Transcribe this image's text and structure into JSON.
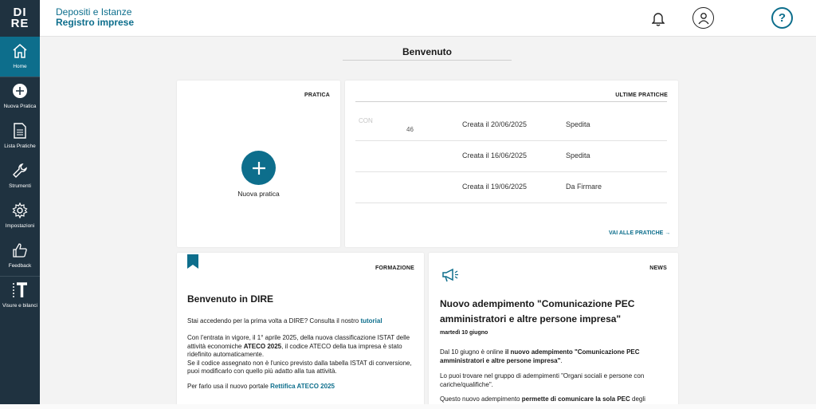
{
  "sidebar": {
    "logo": [
      "DI",
      "RE"
    ],
    "items": [
      {
        "label": "Home",
        "icon": "home-icon",
        "active": true
      },
      {
        "label": "Nuova Pratica",
        "icon": "plus-circle-icon"
      },
      {
        "label": "Lista Pratiche",
        "icon": "document-icon"
      },
      {
        "label": "Strumenti",
        "icon": "wrench-icon"
      },
      {
        "label": "Impostazioni",
        "icon": "gear-icon"
      },
      {
        "label": "Feedback",
        "icon": "thumbs-up-icon"
      },
      {
        "label": "Visure e bilanci",
        "icon": "visure-icon"
      }
    ]
  },
  "header": {
    "title": "Depositi e Istanze",
    "subtitle": "Registro imprese",
    "help": "?"
  },
  "welcome": "Benvenuto",
  "pratica": {
    "tag": "PRATICA",
    "button_label": "Nuova pratica"
  },
  "ultime": {
    "tag": "ULTIME PRATICHE",
    "rows": [
      {
        "name_line1": "CON",
        "name_line2": "46",
        "date": "Creata il 20/06/2025",
        "status": "Spedita"
      },
      {
        "name_line1": "",
        "name_line2": "",
        "date": "Creata il 16/06/2025",
        "status": "Spedita"
      },
      {
        "name_line1": "",
        "name_line2": "",
        "date": "Creata il 19/06/2025",
        "status": "Da Firmare"
      }
    ],
    "link": "VAI ALLE PRATICHE →"
  },
  "formazione": {
    "tag": "FORMAZIONE",
    "title": "Benvenuto in DIRE",
    "p1_pre": "Stai accedendo per la prima volta a DIRE? Consulta il nostro ",
    "p1_link": "tutorial",
    "p2_a": "Con l'entrata in vigore, il 1° aprile 2025, della nuova classificazione ISTAT delle attività economiche ",
    "p2_b": "ATECO 2025",
    "p2_c": ", il codice ATECO della tua impresa è stato ridefinito automaticamente.",
    "p2_d": "Se il codice assegnato non è l'unico previsto dalla tabella ISTAT di conversione, puoi modificarlo con quello più adatto alla tua attività.",
    "p3_pre": "Per farlo usa il nuovo portale ",
    "p3_link": "Rettifica ATECO 2025"
  },
  "news": {
    "tag": "NEWS",
    "title": "Nuovo adempimento \"Comunicazione PEC amministratori e altre persone impresa\"",
    "date": "martedì 10 giugno",
    "p1_a": "Dal 10 giugno è online ",
    "p1_b": "il nuovo adempimento \"Comunicazione PEC amministratori e altre persone impresa\"",
    "p1_c": ".",
    "p2": "Lo puoi trovare nel gruppo di adempimenti \"Organi sociali e persone con cariche/qualifiche\".",
    "p3_a": "Questo nuovo adempimento ",
    "p3_b": "permette di comunicare la sola PEC",
    "p3_c": " degli"
  }
}
